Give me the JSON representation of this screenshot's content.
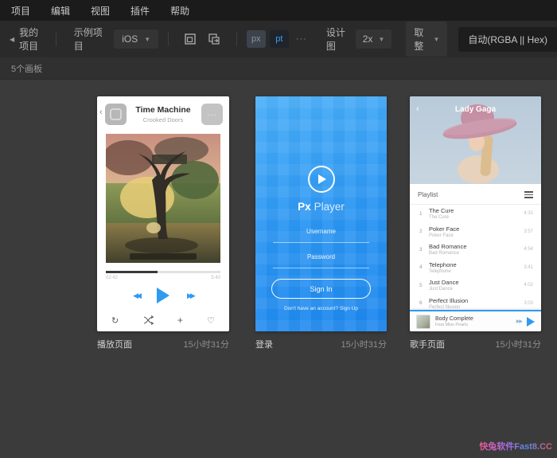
{
  "menu_bar": {
    "items": [
      "项目",
      "编辑",
      "视图",
      "插件",
      "帮助"
    ]
  },
  "toolbar": {
    "back_label": "我的项目",
    "sample_label": "示例项目",
    "platform_selected": "iOS",
    "unit_px": "px",
    "unit_pt": "pt",
    "unit_more": "···",
    "design_label": "设计图",
    "design_scale": "2x",
    "round_label": "取整",
    "color_mode": "自动(RGBA || Hex)"
  },
  "countbar": {
    "artboard_count": "5个画板"
  },
  "artboards": [
    {
      "name": "播放页面",
      "time": "15小时31分",
      "player": {
        "title": "Time Machine",
        "subtitle": "Crooked Doors",
        "more": "···",
        "time_current": "02:42",
        "time_total": "5:40",
        "progress_pct": 45,
        "rewind": "◀◀",
        "play": "",
        "forward": "▶▶",
        "repeat": "↻",
        "plus": "+",
        "heart": "♡"
      }
    },
    {
      "name": "登录",
      "time": "15小时31分",
      "login": {
        "app_name_bold": "Px",
        "app_name_light": "Player",
        "username_placeholder": "Username",
        "password_placeholder": "Password",
        "sign_in": "Sign In",
        "signup_hint": "Don't have an account?  Sign Up"
      }
    },
    {
      "name": "歌手页面",
      "time": "15小时31分",
      "singer": {
        "header": "Lady Gaga",
        "back": "‹",
        "playlist_label": "Playlist",
        "songs": [
          {
            "num": "1",
            "title": "The Cure",
            "subtitle": "The Cure",
            "duration": "4:31"
          },
          {
            "num": "2",
            "title": "Poker Face",
            "subtitle": "Poker Face",
            "duration": "3:57"
          },
          {
            "num": "3",
            "title": "Bad Romance",
            "subtitle": "Bad Romance",
            "duration": "4:54"
          },
          {
            "num": "4",
            "title": "Telephone",
            "subtitle": "Telephone",
            "duration": "3:41"
          },
          {
            "num": "5",
            "title": "Just Dance",
            "subtitle": "Just Dance",
            "duration": "4:02"
          },
          {
            "num": "6",
            "title": "Perfect Illusion",
            "subtitle": "Perfect Illusion",
            "duration": "3:03"
          }
        ],
        "mini_player": {
          "title": "Body Complete",
          "subtitle": "Feat Miss Pearls",
          "skip": "▶▶"
        }
      }
    }
  ],
  "watermark": "快兔软件Fast8.CC",
  "colors": {
    "accent": "#2e9bf2",
    "menu_bg": "#1b1b1b",
    "toolbar_bg": "#2a2a2a",
    "canvas_bg": "#3b3b3b"
  }
}
